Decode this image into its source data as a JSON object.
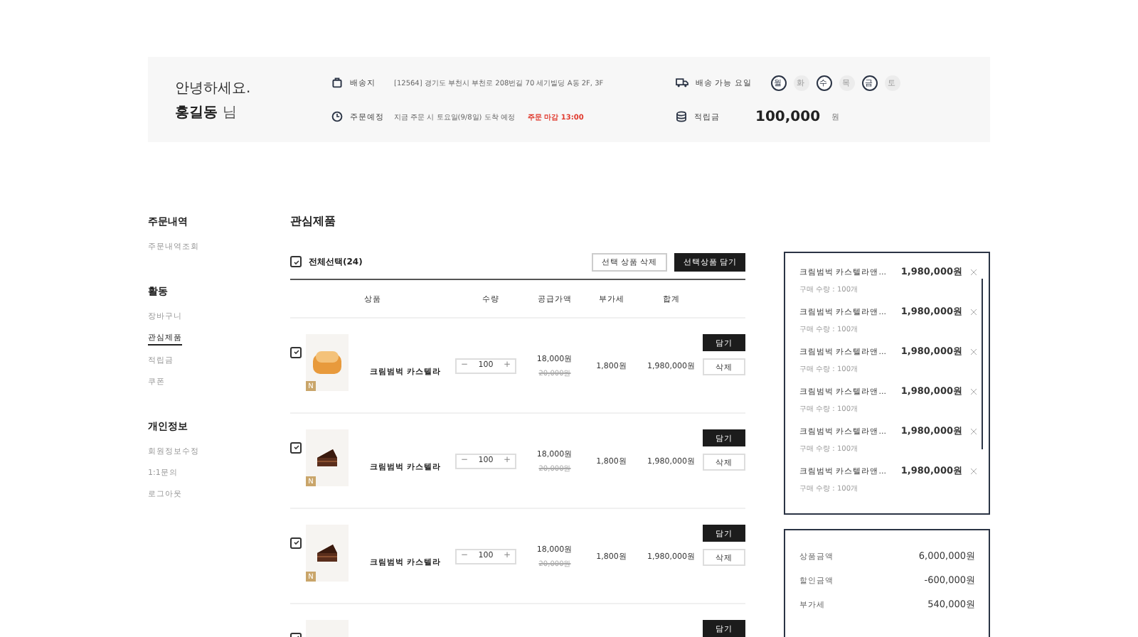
{
  "greeting": {
    "line1": "안녕하세요.",
    "name": "홍길동",
    "suffix": "님"
  },
  "info": [
    {
      "label": "배송지",
      "value": "[12564] 경기도 부천시 부천로 208번길 70 세기빌딩 A동 2F, 3F"
    },
    {
      "label": "주문예정",
      "value": "지금 주문 시 토요일(9/8일) 도착 예정",
      "highlight": "주문 마감 13:00"
    }
  ],
  "delivery": {
    "label": "배송 가능 요일",
    "days": [
      {
        "label": "월",
        "selected": true
      },
      {
        "label": "화",
        "selected": false
      },
      {
        "label": "수",
        "selected": true
      },
      {
        "label": "목",
        "selected": false
      },
      {
        "label": "금",
        "selected": true
      },
      {
        "label": "토",
        "selected": false
      }
    ]
  },
  "points": {
    "label": "적립금",
    "amount": "100,000",
    "unit": "원"
  },
  "sidebar": [
    {
      "title": "주문내역",
      "items": [
        {
          "label": "주문내역조회",
          "selected": false
        }
      ]
    },
    {
      "title": "활동",
      "items": [
        {
          "label": "장바구니",
          "selected": false
        },
        {
          "label": "관심제품",
          "selected": true
        },
        {
          "label": "적립금",
          "selected": false
        },
        {
          "label": "쿠폰",
          "selected": false
        }
      ]
    },
    {
      "title": "개인정보",
      "items": [
        {
          "label": "회원정보수정",
          "selected": false
        },
        {
          "label": "1:1문의",
          "selected": false
        },
        {
          "label": "로그아웃",
          "selected": false
        }
      ]
    }
  ],
  "page_title": "관심제품",
  "select_all": {
    "label": "전체선택(24)",
    "checked": true
  },
  "actions": [
    "선택 상품 삭제",
    "선택상품 담기"
  ],
  "table": {
    "columns": [
      "상품",
      "수량",
      "공급가액",
      "부가세",
      "합계"
    ],
    "rows": [
      {
        "kind": "bread",
        "checked": true,
        "badge": "N",
        "name": "크림범벅 카스텔라",
        "minus": "−",
        "qty": "100",
        "plus": "+",
        "price": "18,000원",
        "original": "20,000원",
        "vat": "1,800원",
        "total": "1,980,000원",
        "add": "담기",
        "remove": "삭제"
      },
      {
        "kind": "cake",
        "checked": true,
        "badge": "N",
        "name": "크림범벅 카스텔라",
        "minus": "−",
        "qty": "100",
        "plus": "+",
        "price": "18,000원",
        "original": "20,000원",
        "vat": "1,800원",
        "total": "1,980,000원",
        "add": "담기",
        "remove": "삭제"
      },
      {
        "kind": "cake",
        "checked": true,
        "badge": "N",
        "name": "크림범벅 카스텔라",
        "minus": "−",
        "qty": "100",
        "plus": "+",
        "price": "18,000원",
        "original": "20,000원",
        "vat": "1,800원",
        "total": "1,980,000원",
        "add": "담기",
        "remove": "삭제"
      },
      {
        "kind": "blank",
        "checked": true,
        "add": "담기"
      }
    ]
  },
  "cart": [
    {
      "name": "크림범벅 카스텔라앤...",
      "qty": "구매 수량 : 100개",
      "price": "1,980,000원"
    },
    {
      "name": "크림범벅 카스텔라앤...",
      "qty": "구매 수량 : 100개",
      "price": "1,980,000원"
    },
    {
      "name": "크림범벅 카스텔라앤...",
      "qty": "구매 수량 : 100개",
      "price": "1,980,000원"
    },
    {
      "name": "크림범벅 카스텔라앤...",
      "qty": "구매 수량 : 100개",
      "price": "1,980,000원"
    },
    {
      "name": "크림범벅 카스텔라앤...",
      "qty": "구매 수량 : 100개",
      "price": "1,980,000원"
    },
    {
      "name": "크림범벅 카스텔라앤...",
      "qty": "구매 수량 : 100개",
      "price": "1,980,000원"
    }
  ],
  "summary": [
    {
      "label": "상품금액",
      "value": "6,000,000원"
    },
    {
      "label": "할인금액",
      "value": "-600,000원"
    },
    {
      "label": "부가세",
      "value": "540,000원"
    }
  ]
}
